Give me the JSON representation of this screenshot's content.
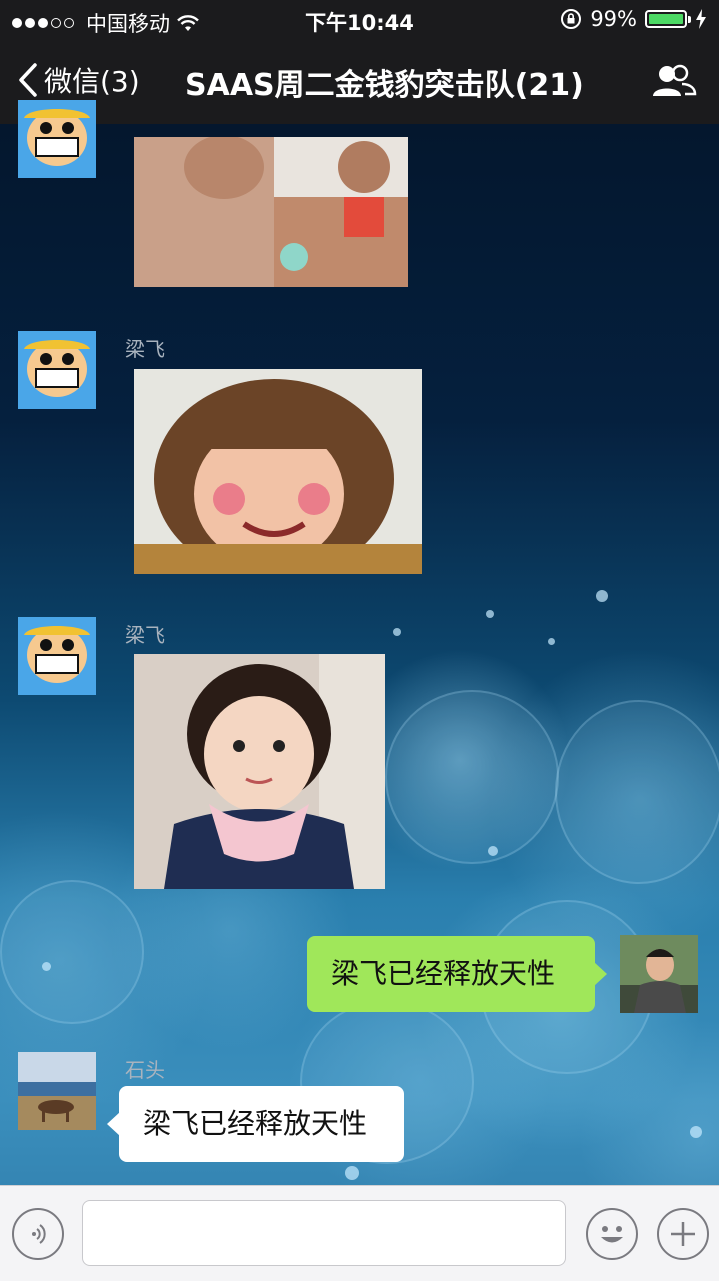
{
  "status_bar": {
    "carrier": "中国移动",
    "time": "下午10:44",
    "battery_percent": "99%",
    "battery_level": 0.99,
    "icons": [
      "signal-dots-icon",
      "wifi-icon",
      "orientation-lock-icon",
      "battery-icon",
      "charging-icon"
    ]
  },
  "nav": {
    "back_label": "微信(3)",
    "title": "SAAS周二金钱豹突击队(21)",
    "icons": [
      "back-chevron-icon",
      "group-members-icon"
    ]
  },
  "messages": [
    {
      "type": "image",
      "direction": "incoming",
      "sender": "",
      "image_desc": "sticker-men"
    },
    {
      "type": "image",
      "direction": "incoming",
      "sender": "梁飞",
      "image_desc": "sticker-funny-face"
    },
    {
      "type": "image",
      "direction": "incoming",
      "sender": "梁飞",
      "image_desc": "sticker-toddler"
    },
    {
      "type": "text",
      "direction": "outgoing",
      "sender": "",
      "text": "梁飞已经释放天性"
    },
    {
      "type": "text",
      "direction": "incoming",
      "sender": "石头",
      "text": "梁飞已经释放天性"
    }
  ],
  "input_bar": {
    "placeholder": "",
    "icons": [
      "voice-icon",
      "emoji-icon",
      "plus-icon"
    ]
  },
  "colors": {
    "nav_bg": "#1b1b1d",
    "outgoing_bubble": "#a0e75a",
    "incoming_bubble": "#ffffff",
    "battery_fill": "#4cd964"
  }
}
